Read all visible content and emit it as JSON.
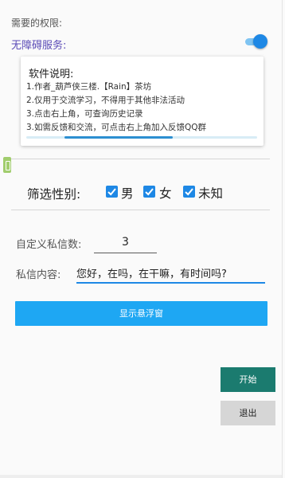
{
  "permissions": {
    "title": "需要的权限:",
    "accessibility_label": "无障碍服务:",
    "accessibility_enabled": true
  },
  "info_card": {
    "title": "软件说明:",
    "lines": [
      "1.作者_葫芦侠三楼.【Rain】茶坊",
      "2.仅用于交流学习，不得用于其他非法活动",
      "3.点击右上角，可查询历史记录",
      "3.如需反馈和交流，可点击右上角加入反馈QQ群"
    ]
  },
  "filter": {
    "label": "筛选性别:",
    "options": [
      {
        "label": "男",
        "checked": true
      },
      {
        "label": "女",
        "checked": true
      },
      {
        "label": "未知",
        "checked": true
      }
    ]
  },
  "form": {
    "count_label": "自定义私信数:",
    "count_value": "3",
    "message_label": "私信内容:",
    "message_value": "您好，在吗，在干嘛，有时间吗?"
  },
  "buttons": {
    "show_float": "显示悬浮窗",
    "start": "开始",
    "exit": "退出"
  },
  "colors": {
    "accent": "#1e88e5",
    "float_button": "#1ea7f3",
    "start_button": "#1b7b6f"
  }
}
